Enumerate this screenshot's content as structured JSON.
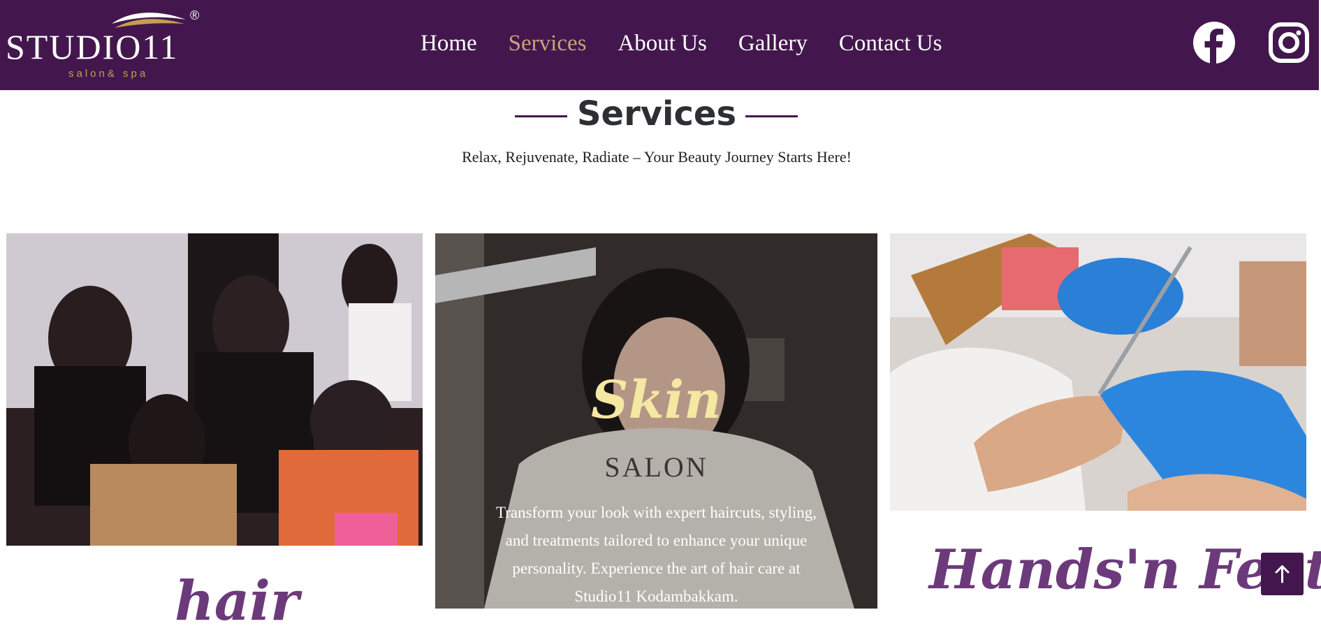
{
  "brand": {
    "name": "STUDIO11",
    "tagline": "salon& spa",
    "registered_mark": "®"
  },
  "nav": {
    "items": [
      {
        "label": "Home",
        "active": false
      },
      {
        "label": "Services",
        "active": true
      },
      {
        "label": "About Us",
        "active": false
      },
      {
        "label": "Gallery",
        "active": false
      },
      {
        "label": "Contact Us",
        "active": false
      }
    ]
  },
  "social": {
    "facebook_icon": "facebook-icon",
    "instagram_icon": "instagram-icon"
  },
  "section": {
    "title": "Services",
    "subtitle": "Relax, Rejuvenate, Radiate – Your Beauty Journey Starts Here!"
  },
  "cards": {
    "hair": {
      "heading": "hair"
    },
    "skin": {
      "heading": "Skin",
      "label": "SALON",
      "description": "Transform your look with expert haircuts, styling, and treatments tailored to enhance your unique personality. Experience the art of hair care at Studio11 Kodambakkam."
    },
    "hands": {
      "heading": "Hands'n Feet"
    }
  },
  "scroll_top": {
    "icon": "arrow-up-icon"
  },
  "colors": {
    "header_bg": "#43174d",
    "nav_active": "#c9a27a",
    "accent_purple": "#6c3a7a",
    "skin_title": "#f4e8a2"
  }
}
